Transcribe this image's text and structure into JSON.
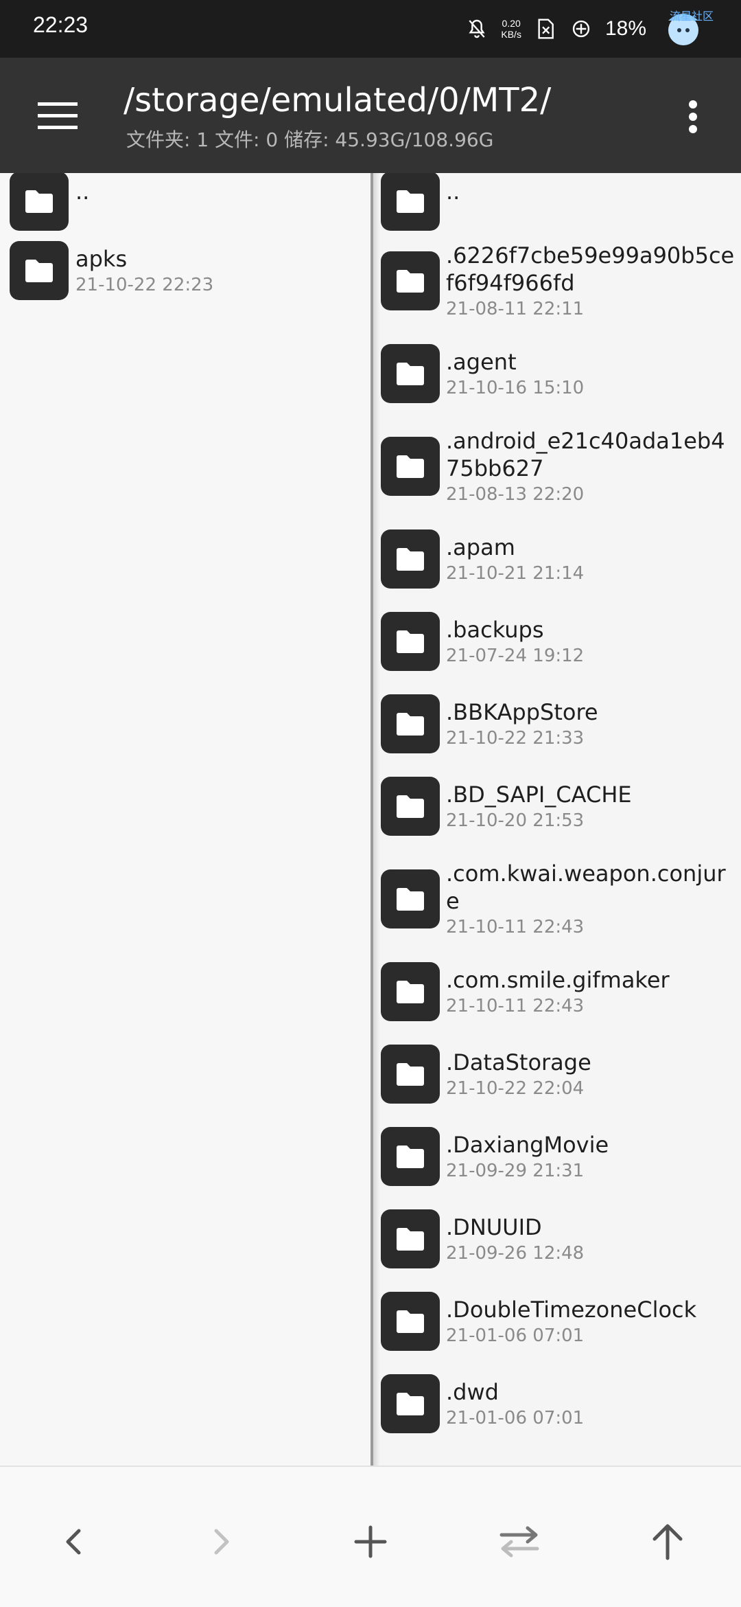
{
  "status_bar": {
    "time": "22:23",
    "net_speed_value": "0.20",
    "net_speed_unit": "KB/s",
    "battery": "18%",
    "watermark": "流星社区"
  },
  "app_bar": {
    "path": "/storage/emulated/0/MT2/",
    "summary": "文件夹: 1  文件: 0  储存: 45.93G/108.96G"
  },
  "left_panel": {
    "items": [
      {
        "name": "..",
        "date": ""
      },
      {
        "name": "apks",
        "date": "21-10-22 22:23"
      }
    ]
  },
  "right_panel": {
    "items": [
      {
        "name": "..",
        "date": ""
      },
      {
        "name": ".6226f7cbe59e99a90b5cef6f94f966fd",
        "date": "21-08-11 22:11"
      },
      {
        "name": ".agent",
        "date": "21-10-16 15:10"
      },
      {
        "name": ".android_e21c40ada1eb475bb627",
        "date": "21-08-13 22:20"
      },
      {
        "name": ".apam",
        "date": "21-10-21 21:14"
      },
      {
        "name": ".backups",
        "date": "21-07-24 19:12"
      },
      {
        "name": ".BBKAppStore",
        "date": "21-10-22 21:33"
      },
      {
        "name": ".BD_SAPI_CACHE",
        "date": "21-10-20 21:53"
      },
      {
        "name": ".com.kwai.weapon.conjure",
        "date": "21-10-11 22:43"
      },
      {
        "name": ".com.smile.gifmaker",
        "date": "21-10-11 22:43"
      },
      {
        "name": ".DataStorage",
        "date": "21-10-22 22:04"
      },
      {
        "name": ".DaxiangMovie",
        "date": "21-09-29 21:31"
      },
      {
        "name": ".DNUUID",
        "date": "21-09-26 12:48"
      },
      {
        "name": ".DoubleTimezoneClock",
        "date": "21-01-06 07:01"
      },
      {
        "name": ".dwd",
        "date": "21-01-06 07:01"
      }
    ]
  },
  "bottom_bar": {
    "buttons": [
      "back-icon",
      "forward-icon",
      "add-icon",
      "swap-icon",
      "up-icon"
    ]
  }
}
